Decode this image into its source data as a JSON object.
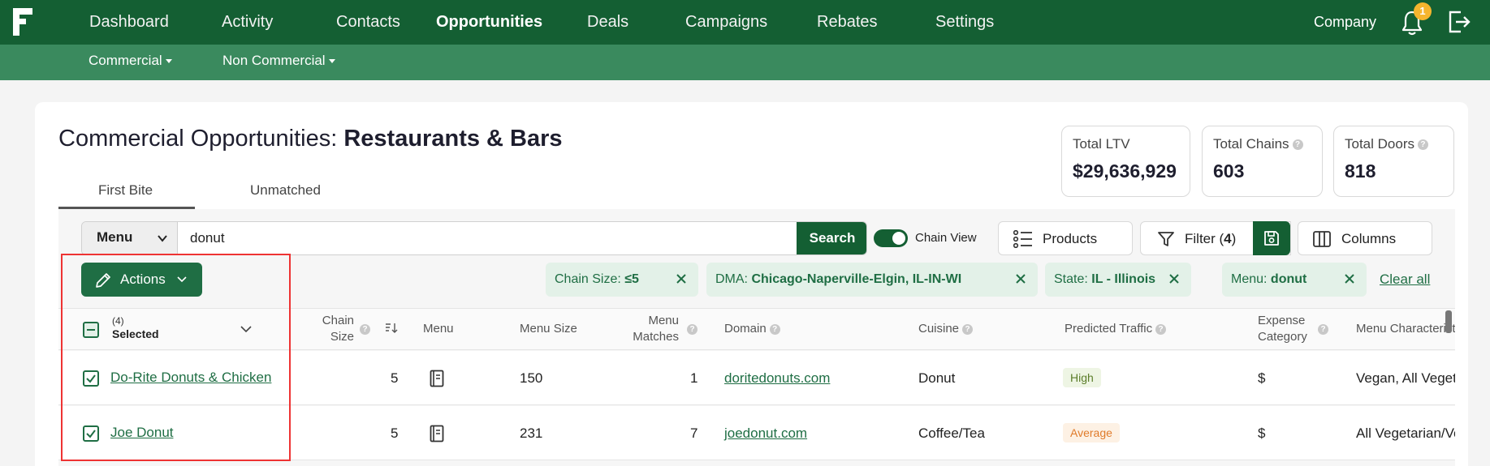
{
  "nav": {
    "items": [
      "Dashboard",
      "Activity",
      "Contacts",
      "Opportunities",
      "Deals",
      "Campaigns",
      "Rebates",
      "Settings"
    ],
    "active": "Opportunities",
    "company_label": "Company",
    "notification_count": "1"
  },
  "subnav": {
    "items": [
      "Commercial",
      "Non Commercial"
    ]
  },
  "page": {
    "title_prefix": "Commercial Opportunities:",
    "title_bold": "Restaurants & Bars",
    "tabs": [
      "First Bite",
      "Unmatched"
    ],
    "active_tab": "First Bite"
  },
  "stats": [
    {
      "label": "Total LTV",
      "value": "$29,636,929"
    },
    {
      "label": "Total Chains",
      "value": "603"
    },
    {
      "label": "Total Doors",
      "value": "818"
    }
  ],
  "search": {
    "type": "Menu",
    "value": "donut",
    "button_label": "Search",
    "chain_view_label": "Chain View",
    "chain_view_on": true
  },
  "toolbar": {
    "products_label": "Products",
    "filter_label": "Filter (",
    "filter_count": "4",
    "filter_close": ")",
    "columns_label": "Columns",
    "actions_label": "Actions"
  },
  "filters": [
    {
      "key": "Chain Size: ",
      "value": "≤5"
    },
    {
      "key": "DMA: ",
      "value": "Chicago-Naperville-Elgin, IL-IN-WI"
    },
    {
      "key": "State: ",
      "value": "IL - Illinois"
    },
    {
      "key": "Menu: ",
      "value": "donut"
    }
  ],
  "clear_all_label": "Clear all",
  "table": {
    "selected_count": "(4)",
    "selected_label": "Selected",
    "headers": {
      "chain_size": [
        "Chain",
        "Size"
      ],
      "menu": "Menu",
      "menu_size": "Menu Size",
      "menu_matches": [
        "Menu",
        "Matches"
      ],
      "domain": "Domain",
      "cuisine": "Cuisine",
      "predicted_traffic": "Predicted Traffic",
      "expense_category": [
        "Expense",
        "Category"
      ],
      "menu_characteristics": "Menu Characteristics"
    },
    "rows": [
      {
        "name": "Do-Rite Donuts & Chicken",
        "chain_size": "5",
        "menu_size": "150",
        "menu_matches": "1",
        "domain": "doritedonuts.com",
        "cuisine": "Donut",
        "traffic": "High",
        "expense": "$",
        "characteristics": "Vegan, All Vegetarian"
      },
      {
        "name": "Joe Donut",
        "chain_size": "5",
        "menu_size": "231",
        "menu_matches": "7",
        "domain": "joedonut.com",
        "cuisine": "Coffee/Tea",
        "traffic": "Average",
        "expense": "$",
        "characteristics": "All Vegetarian/Vegan"
      }
    ]
  },
  "colors": {
    "brand": "#145f33",
    "subnav": "#3a8a5e",
    "badge": "#f5b52e",
    "highlight": "#e33333"
  }
}
